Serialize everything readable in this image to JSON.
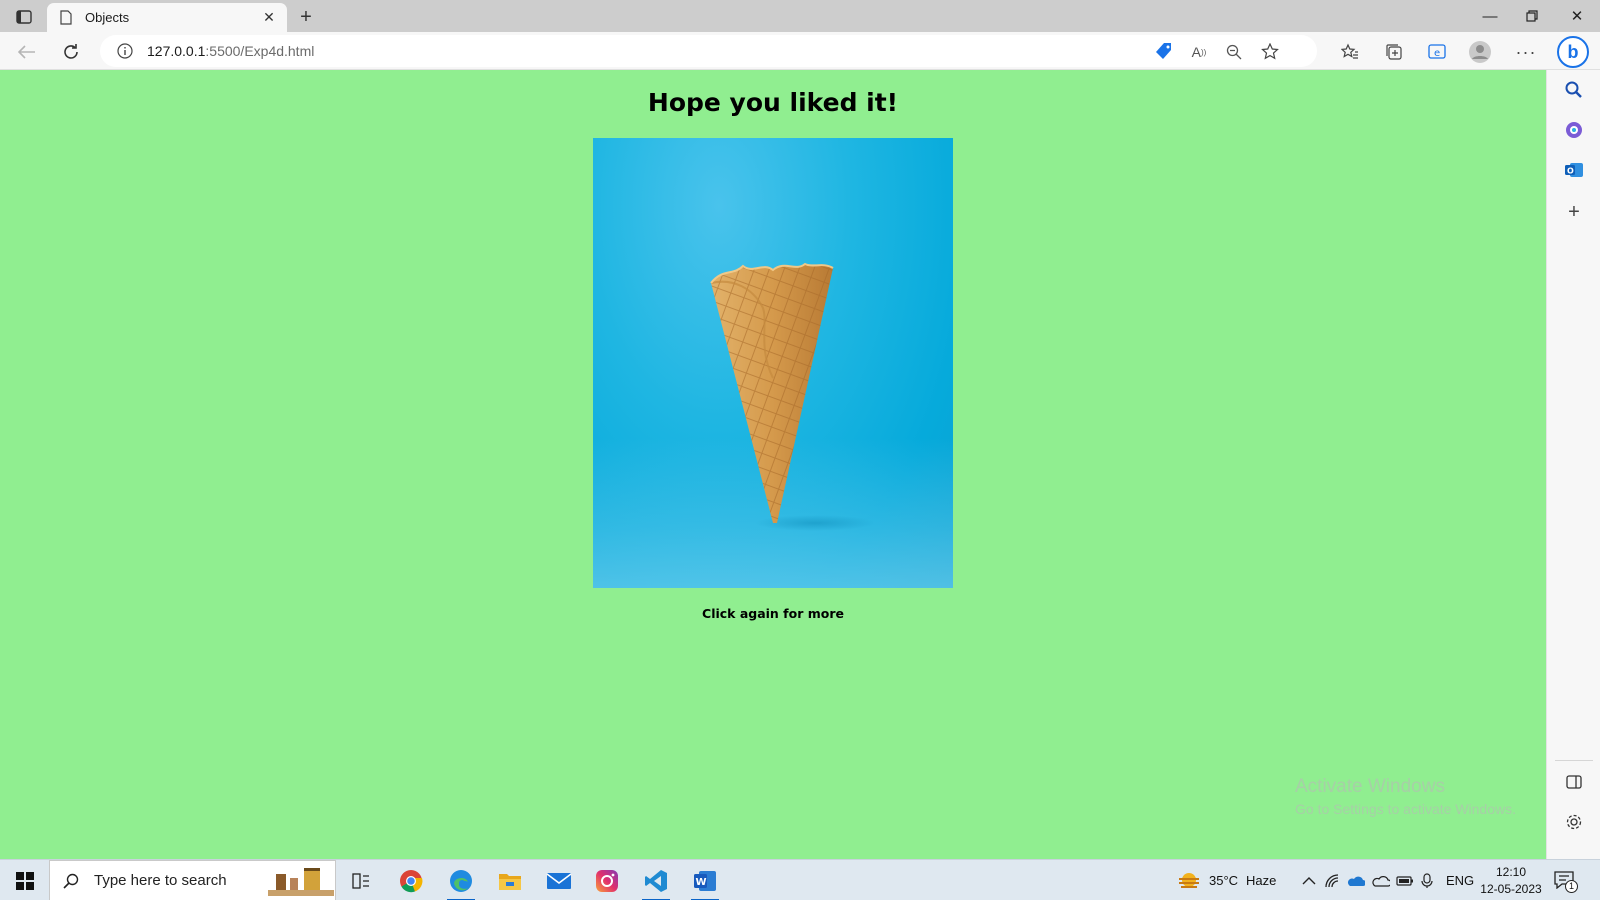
{
  "browser": {
    "tab": {
      "title": "Objects"
    },
    "address": {
      "host": "127.0.0.1",
      "path": ":5500/Exp4d.html"
    }
  },
  "page": {
    "heading": "Hope you liked it!",
    "subtext": "Click again for more",
    "image_subject": "ice-cream-cone",
    "background": "#90ee90"
  },
  "watermark": {
    "line1": "Activate Windows",
    "line2": "Go to Settings to activate Windows."
  },
  "taskbar": {
    "search_placeholder": "Type here to search",
    "weather": {
      "temp": "35°C",
      "condition": "Haze"
    },
    "language": "ENG",
    "time": "12:10",
    "date": "12-05-2023",
    "notification_count": "1"
  }
}
